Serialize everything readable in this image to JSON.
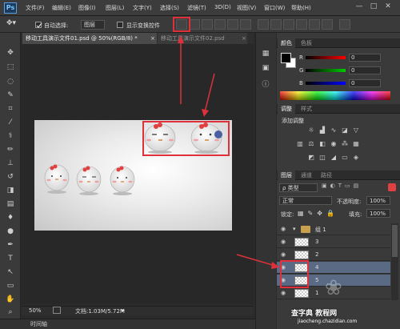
{
  "app": {
    "logo": "Ps"
  },
  "menu": [
    "文件(F)",
    "编辑(E)",
    "图像(I)",
    "图层(L)",
    "文字(Y)",
    "选择(S)",
    "滤镜(T)",
    "3D(D)",
    "视图(V)",
    "窗口(W)",
    "帮助(H)"
  ],
  "window_controls": [
    "—",
    "□",
    "✕"
  ],
  "options": {
    "auto_select_label": "自动选择:",
    "auto_select_value": "图层",
    "show_transform_label": "显示变换控件"
  },
  "document_tabs": [
    {
      "label": "移动工具演示文件01.psd @ 50%(RGB/8) *",
      "close": "×"
    },
    {
      "label": "移动工具演示文件02.psd",
      "close": "×"
    }
  ],
  "status": {
    "zoom": "50%",
    "doc_info": "文档:1.03M/5.72M"
  },
  "timeline": {
    "label": "时间轴"
  },
  "color_panel": {
    "tabs": [
      "颜色",
      "色板"
    ],
    "channels": [
      {
        "label": "R",
        "value": "0"
      },
      {
        "label": "G",
        "value": "0"
      },
      {
        "label": "B",
        "value": "0"
      }
    ]
  },
  "adjust_panel": {
    "tabs": [
      "调整",
      "样式"
    ],
    "title": "添加调整"
  },
  "layers_panel": {
    "tabs": [
      "图层",
      "通道",
      "路径"
    ],
    "filter_value": "ρ 类型",
    "blend_mode": "正常",
    "opacity_label": "不透明度:",
    "opacity_value": "100%",
    "lock_label": "锁定:",
    "fill_label": "填充:",
    "fill_value": "100%",
    "layers": [
      {
        "name": "组 1",
        "type": "group",
        "selected": false
      },
      {
        "name": "3",
        "type": "layer",
        "selected": false
      },
      {
        "name": "2",
        "type": "layer",
        "selected": false
      },
      {
        "name": "4",
        "type": "layer",
        "selected": true
      },
      {
        "name": "5",
        "type": "layer",
        "selected": true
      },
      {
        "name": "1",
        "type": "layer",
        "selected": false
      }
    ]
  },
  "watermark": {
    "line1": "查字典 教程网",
    "line2": "jiaocheng.chazidian.com"
  },
  "colors": {
    "accent_red": "#e0303a",
    "selected_layer": "#5a6a85"
  }
}
